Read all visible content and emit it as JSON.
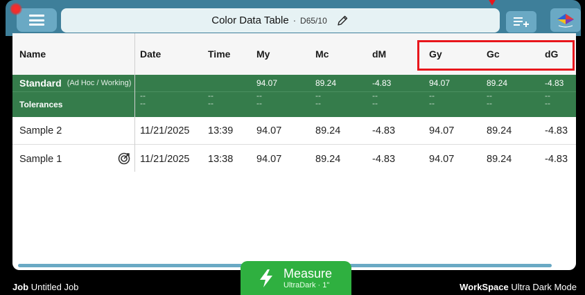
{
  "header": {
    "title": "Color Data Table",
    "separator": "·",
    "illuminant": "D65/10"
  },
  "table": {
    "columns": [
      "Name",
      "Date",
      "Time",
      "My",
      "Mc",
      "dM",
      "Gy",
      "Gc",
      "dG"
    ],
    "standard": {
      "name": "Standard",
      "note": "(Ad Hoc / Working)",
      "values": [
        "",
        "",
        "94.07",
        "89.24",
        "-4.83",
        "94.07",
        "89.24",
        "-4.83"
      ]
    },
    "tolerances": {
      "name": "Tolerances",
      "dash": "--"
    },
    "rows": [
      {
        "name": "Sample 2",
        "values": [
          "11/21/2025",
          "13:39",
          "94.07",
          "89.24",
          "-4.83",
          "94.07",
          "89.24",
          "-4.83"
        ]
      },
      {
        "name": "Sample 1",
        "values": [
          "11/21/2025",
          "13:38",
          "94.07",
          "89.24",
          "-4.83",
          "94.07",
          "89.24",
          "-4.83"
        ]
      }
    ]
  },
  "footer": {
    "job_label": "Job",
    "job_value": "Untitled Job",
    "workspace_label": "WorkSpace",
    "workspace_value": "Ultra Dark Mode"
  },
  "measure": {
    "label": "Measure",
    "sub": "UltraDark · 1\""
  },
  "icons": {
    "menu": "hamburger-menu-icon",
    "edit": "pencil-icon",
    "add_list": "add-list-icon",
    "color": "color-diamond-icon",
    "target": "target-icon",
    "measure": "lightning-bolt-icon"
  },
  "colors": {
    "top_bar": "#3e7f9a",
    "button": "#6aa9c4",
    "standard_row": "#357c4b",
    "measure_button": "#2fb040",
    "highlight": "#e8161c"
  }
}
